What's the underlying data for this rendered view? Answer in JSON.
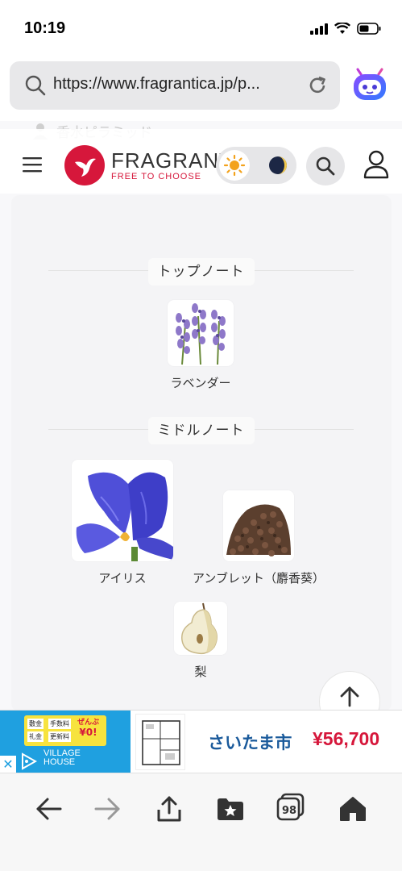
{
  "status_bar": {
    "time": "10:19"
  },
  "browser": {
    "url": "https://www.fragrantica.jp/p...",
    "icons": {
      "search": "search-icon",
      "reload": "reload-icon",
      "assistant": "assistant-icon"
    }
  },
  "page": {
    "ghost_heading": "香水ピラミッド",
    "logo": {
      "word": "FRAGRANTICA",
      "tagline": "FREE TO CHOOSE"
    },
    "sections": [
      {
        "title": "トップノート",
        "notes": [
          {
            "label": "ラベンダー",
            "image": "lavender"
          }
        ]
      },
      {
        "title": "ミドルノート",
        "notes": [
          {
            "label": "アイリス",
            "image": "iris"
          },
          {
            "label": "アンブレット（麝香葵）",
            "image": "ambrette-seeds"
          },
          {
            "label": "梨",
            "image": "pear"
          }
        ]
      }
    ]
  },
  "ad": {
    "box_cells": [
      "敷金",
      "手数料",
      "礼金",
      "更新料"
    ],
    "box_free_line1": "ぜんぶ",
    "box_free_line2": "¥0!",
    "brand_line1": "VILLAGE",
    "brand_line2": "HOUSE",
    "city": "さいたま市",
    "price": "¥56,700"
  },
  "toolbar": {
    "tab_count": "98"
  },
  "colors": {
    "brand": "#d6173b",
    "ad_blue": "#1fa0e0",
    "ad_yellow": "#f7e33e",
    "price_red": "#d6173b"
  }
}
